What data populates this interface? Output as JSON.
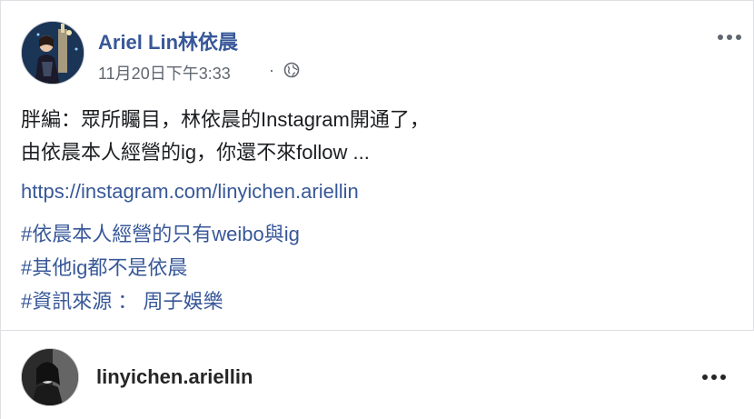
{
  "post": {
    "author_name": "Ariel Lin林依晨",
    "timestamp": "11月20日下午3:33",
    "separator": "·",
    "privacy_icon": "globe-icon",
    "more_icon": "more-options-icon",
    "body_lines": [
      "胖編：眾所矚目，林依晨的Instagram開通了，",
      "由依晨本人經營的ig，你還不來follow ..."
    ],
    "link": "https://instagram.com/linyichen.ariellin",
    "hashtags": [
      "#依晨本人經營的只有weibo與ig",
      "#其他ig都不是依晨",
      "#資訊來源 ： 周子娛樂"
    ]
  },
  "embed": {
    "username": "linyichen.ariellin",
    "more_icon": "more-options-icon"
  },
  "colors": {
    "link_blue": "#385898",
    "meta_gray": "#606770",
    "border": "#dddfe2"
  }
}
